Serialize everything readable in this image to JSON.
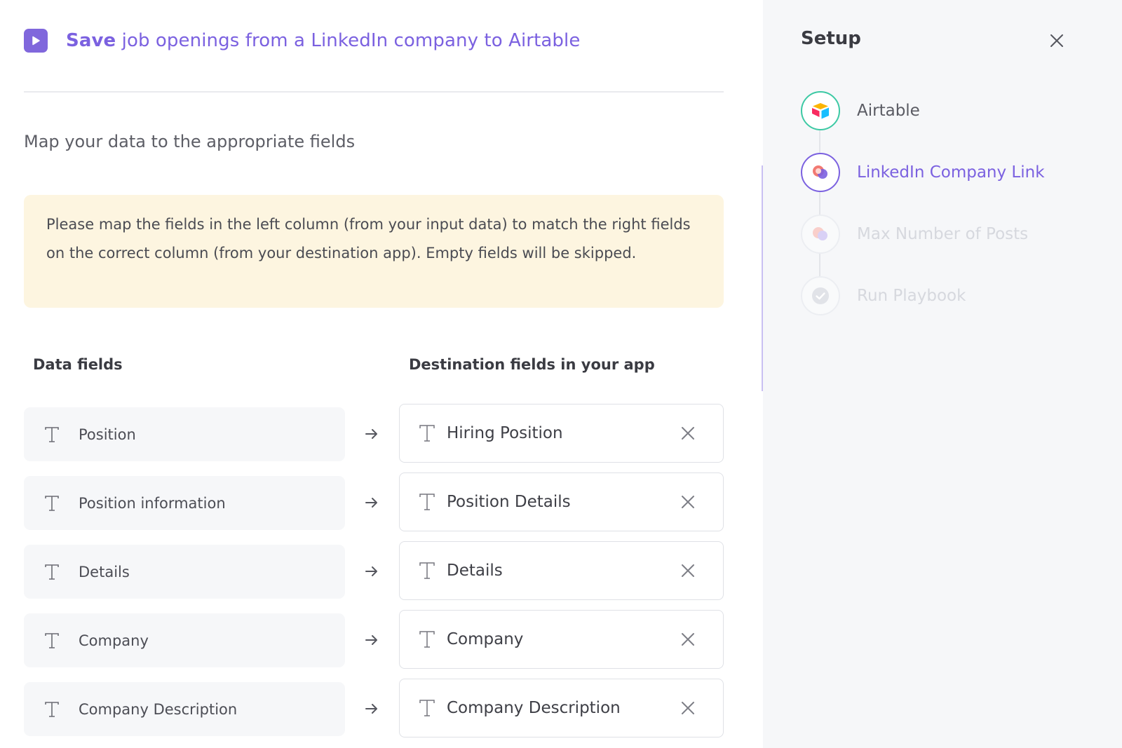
{
  "header": {
    "title_strong": "Save",
    "title_rest": " job openings from a LinkedIn company to Airtable"
  },
  "main": {
    "section_title": "Map your data to the appropriate fields",
    "notice": "Please map the fields in the left column (from your input data) to match the right fields on the correct column (from your destination app). Empty fields will be skipped.",
    "data_fields_header": "Data fields",
    "destination_header": "Destination fields in your app",
    "mappings": [
      {
        "source": "Position",
        "destination": "Hiring Position"
      },
      {
        "source": "Position information",
        "destination": "Position Details"
      },
      {
        "source": "Details",
        "destination": "Details"
      },
      {
        "source": "Company",
        "destination": "Company"
      },
      {
        "source": "Company Description",
        "destination": "Company Description"
      }
    ]
  },
  "sidebar": {
    "title": "Setup",
    "steps": [
      {
        "label": "Airtable",
        "state": "done",
        "icon": "airtable-icon"
      },
      {
        "label": "LinkedIn Company Link",
        "state": "active",
        "icon": "linkedin-company-icon"
      },
      {
        "label": "Max Number of Posts",
        "state": "pending",
        "icon": "posts-icon"
      },
      {
        "label": "Run Playbook",
        "state": "pending",
        "icon": "check-circle-icon"
      }
    ]
  },
  "colors": {
    "accent": "#7b61e0",
    "notice_bg": "#fdf5e0",
    "done": "#3dc9a4"
  }
}
